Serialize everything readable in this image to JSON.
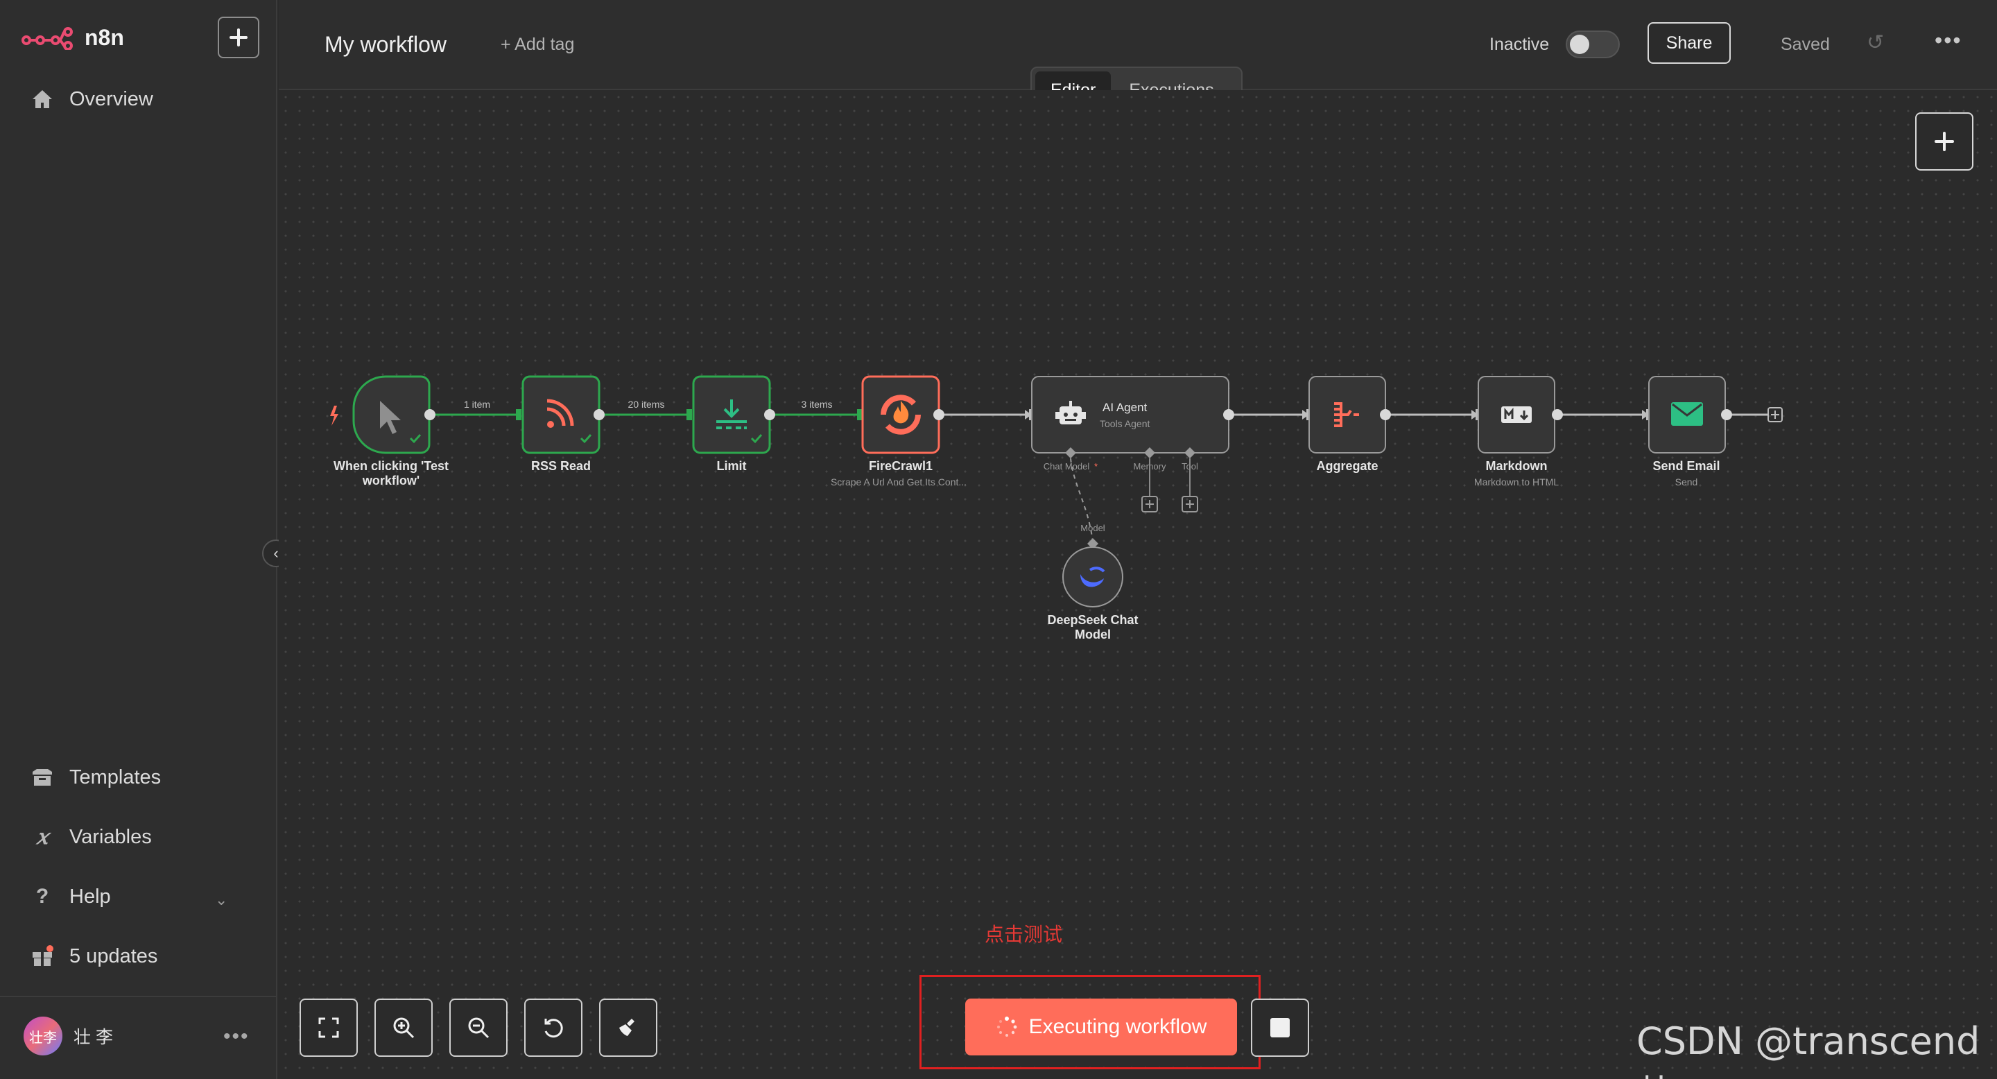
{
  "app": {
    "name": "n8n"
  },
  "sidebar": {
    "overview": "Overview",
    "templates": "Templates",
    "variables": "Variables",
    "help": "Help",
    "updates": "5 updates",
    "user_name": "壮 李",
    "avatar_text": "壮李"
  },
  "header": {
    "workflow_name": "My workflow",
    "add_tag": "+ Add tag",
    "status": "Inactive",
    "share": "Share",
    "saved": "Saved",
    "tabs": [
      "Editor",
      "Executions"
    ]
  },
  "workflow": {
    "nodes": [
      {
        "name": "When clicking 'Test",
        "name2": "workflow'",
        "subtitle": ""
      },
      {
        "name": "RSS Read",
        "subtitle": ""
      },
      {
        "name": "Limit",
        "subtitle": ""
      },
      {
        "name": "FireCrawl1",
        "subtitle": "Scrape A Url And Get Its Cont..."
      },
      {
        "name": "AI Agent",
        "subtitle": "Tools Agent"
      },
      {
        "name": "Aggregate",
        "subtitle": ""
      },
      {
        "name": "Markdown",
        "subtitle": "Markdown to HTML"
      },
      {
        "name": "Send Email",
        "subtitle": "Send"
      },
      {
        "name": "DeepSeek Chat",
        "name2": "Model",
        "subtitle": ""
      }
    ],
    "edge_labels": [
      "1 item",
      "20 items",
      "3 items"
    ],
    "agent_ports": [
      "Chat Model",
      "Memory",
      "Tool"
    ],
    "model_port": "Model",
    "required_mark": "*"
  },
  "footer": {
    "annotation": "点击测试",
    "execute_label": "Executing workflow",
    "watermark": "CSDN @transcend壮"
  },
  "colors": {
    "accent": "#ff6d5a",
    "success": "#2da84e",
    "annotation": "#e53935"
  }
}
